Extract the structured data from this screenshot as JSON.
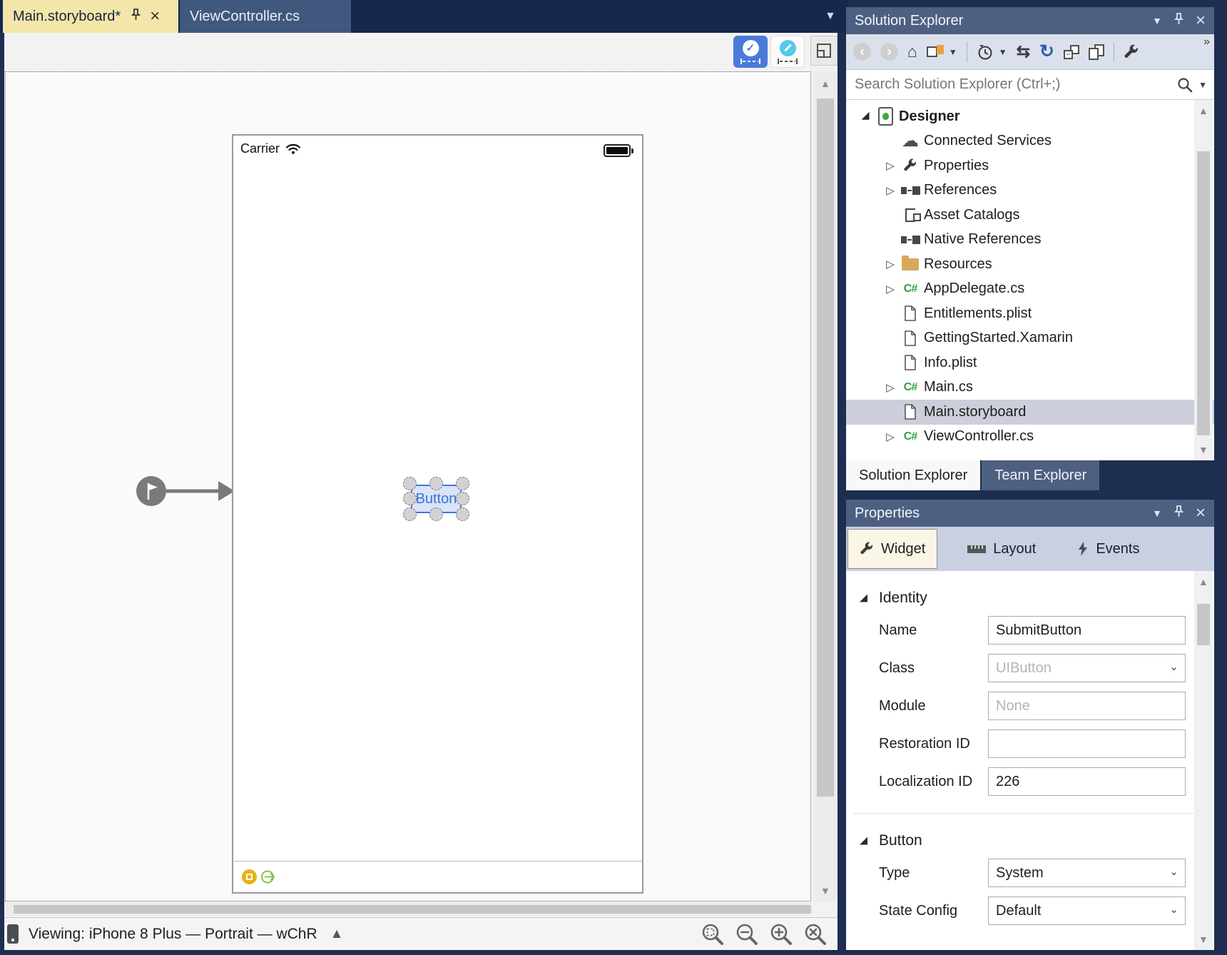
{
  "editor_tabs": {
    "active": "Main.storyboard*",
    "inactive": "ViewController.cs"
  },
  "designer": {
    "carrier_label": "Carrier",
    "button_label": "Button",
    "toolbar_icons": [
      "constraints-check-icon",
      "constraints-edit-icon",
      "split-view-icon"
    ],
    "zoom_icons": [
      "zoom-fit-icon",
      "zoom-out-icon",
      "zoom-in-icon",
      "zoom-actual-size-icon"
    ],
    "viewing_status": "Viewing: iPhone 8 Plus — Portrait — wChR"
  },
  "solution_explorer": {
    "title": "Solution Explorer",
    "search_placeholder": "Search Solution Explorer (Ctrl+;)",
    "toolbar_icons": [
      "back-icon",
      "forward-icon",
      "home-icon",
      "switch-views-icon",
      "pending-changes-filter-icon",
      "sync-icon",
      "refresh-icon",
      "collapse-all-icon",
      "show-all-files-icon",
      "properties-wrench-icon",
      "overflow-icon"
    ],
    "tree": [
      {
        "label": "Designer",
        "icon": "ios-project-icon",
        "expanded": true
      },
      {
        "label": "Connected Services",
        "icon": "connected-services-icon"
      },
      {
        "label": "Properties",
        "icon": "wrench-icon",
        "collapsible": true
      },
      {
        "label": "References",
        "icon": "references-icon",
        "collapsible": true
      },
      {
        "label": "Asset Catalogs",
        "icon": "asset-catalogs-icon"
      },
      {
        "label": "Native References",
        "icon": "references-icon"
      },
      {
        "label": "Resources",
        "icon": "folder-icon",
        "collapsible": true
      },
      {
        "label": "AppDelegate.cs",
        "icon": "csharp-icon",
        "collapsible": true
      },
      {
        "label": "Entitlements.plist",
        "icon": "file-icon"
      },
      {
        "label": "GettingStarted.Xamarin",
        "icon": "file-icon"
      },
      {
        "label": "Info.plist",
        "icon": "file-icon"
      },
      {
        "label": "Main.cs",
        "icon": "csharp-icon",
        "collapsible": true
      },
      {
        "label": "Main.storyboard",
        "icon": "file-icon",
        "selected": true
      },
      {
        "label": "ViewController.cs",
        "icon": "csharp-icon",
        "collapsible": true
      }
    ],
    "bottom_tabs": {
      "solution_explorer": "Solution Explorer",
      "team_explorer": "Team Explorer"
    }
  },
  "properties": {
    "title": "Properties",
    "tabs": {
      "widget": "Widget",
      "layout": "Layout",
      "events": "Events"
    },
    "identity": {
      "heading": "Identity",
      "name_label": "Name",
      "name_value": "SubmitButton",
      "class_label": "Class",
      "class_placeholder": "UIButton",
      "module_label": "Module",
      "module_placeholder": "None",
      "restoration_label": "Restoration ID",
      "restoration_value": "",
      "localization_label": "Localization ID",
      "localization_value": "226"
    },
    "button": {
      "heading": "Button",
      "type_label": "Type",
      "type_value": "System",
      "state_label": "State Config",
      "state_value": "Default"
    }
  },
  "colors": {
    "accent_blue": "#4a7ad8",
    "modified_tab_yellow": "#f3e6a8",
    "panel_header_blue": "#4d6082",
    "chrome_navy": "#1d2e50",
    "selection_gray": "#cccedb",
    "csharp_green": "#2f9e44",
    "segue_green": "#82c24a",
    "badge_yellow": "#e6b412",
    "refresh_blue": "#2b5ea7",
    "cyan_edit": "#56c8e8",
    "ui_button_fill": "#d9e4f8",
    "ui_button_border": "#3e74e8"
  }
}
